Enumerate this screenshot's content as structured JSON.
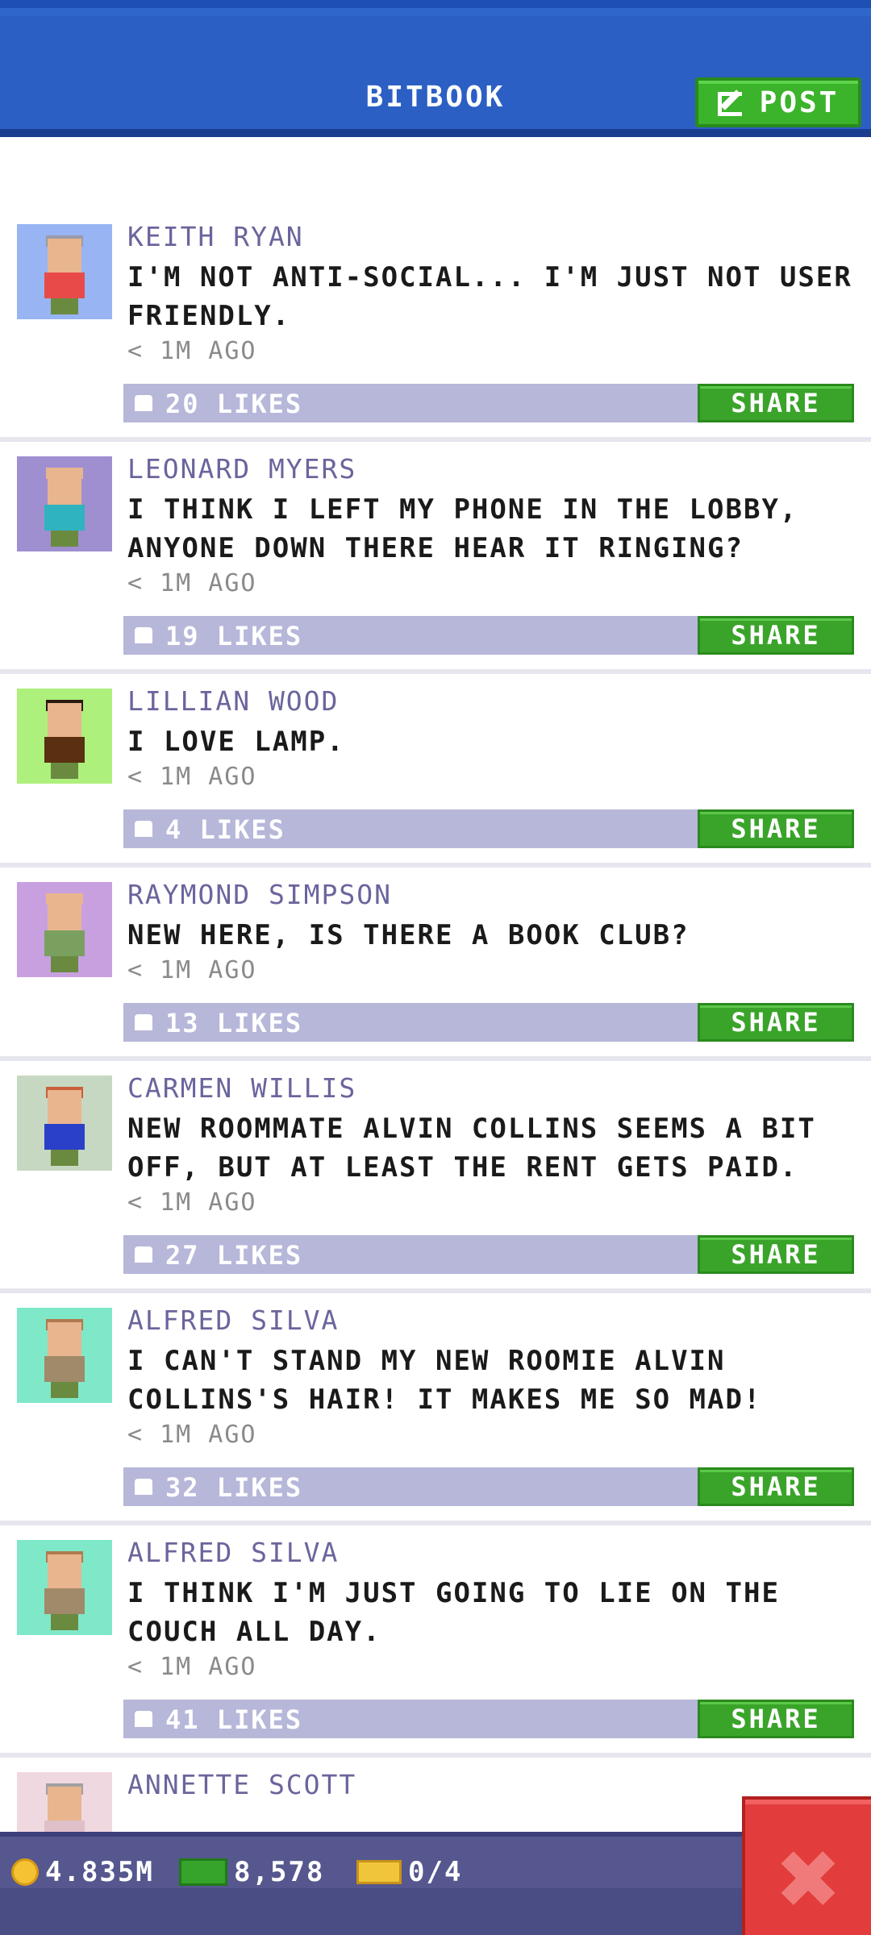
{
  "header": {
    "title": "BITBOOK",
    "post_label": "POST"
  },
  "posts": [
    {
      "name": "KEITH RYAN",
      "text": "I'M NOT ANTI-SOCIAL... I'M JUST NOT USER FRIENDLY.",
      "time": "< 1M AGO",
      "likes": "20 LIKES",
      "share": "SHARE",
      "avatar_bg": "#98b4f2",
      "shirt": "#e84a4a",
      "hair": "#9a9aa6",
      "lines": 2
    },
    {
      "name": "LEONARD MYERS",
      "text": "I THINK I LEFT MY PHONE IN THE LOBBY, ANYONE DOWN THERE HEAR IT RINGING?",
      "time": "< 1M AGO",
      "likes": "19 LIKES",
      "share": "SHARE",
      "avatar_bg": "#9f8fd0",
      "shirt": "#2fb3c0",
      "hair": "#e9b58f",
      "lines": 2
    },
    {
      "name": "LILLIAN WOOD",
      "text": "I LOVE LAMP.",
      "time": "< 1M AGO",
      "likes": "4 LIKES",
      "share": "SHARE",
      "avatar_bg": "#aef07c",
      "shirt": "#5a3010",
      "hair": "#2a1a10",
      "lines": 1
    },
    {
      "name": "RAYMOND SIMPSON",
      "text": "NEW HERE, IS THERE A BOOK CLUB?",
      "time": "< 1M AGO",
      "likes": "13 LIKES",
      "share": "SHARE",
      "avatar_bg": "#c8a0e0",
      "shirt": "#7aa060",
      "hair": "#e9b58f",
      "lines": 1
    },
    {
      "name": "CARMEN WILLIS",
      "text": "NEW ROOMMATE ALVIN COLLINS SEEMS A BIT OFF, BUT AT LEAST THE RENT GETS PAID.",
      "time": "< 1M AGO",
      "likes": "27 LIKES",
      "share": "SHARE",
      "avatar_bg": "#c6d8c2",
      "shirt": "#2a40c8",
      "hair": "#c8603a",
      "lines": 2
    },
    {
      "name": "ALFRED SILVA",
      "text": "I CAN'T STAND MY NEW ROOMIE ALVIN COLLINS'S HAIR! IT MAKES ME SO MAD!",
      "time": "< 1M AGO",
      "likes": "32 LIKES",
      "share": "SHARE",
      "avatar_bg": "#7ee8c8",
      "shirt": "#a08a6a",
      "hair": "#b07a50",
      "lines": 2
    },
    {
      "name": "ALFRED SILVA",
      "text": "I THINK I'M JUST GOING TO LIE ON THE COUCH ALL DAY.",
      "time": "< 1M AGO",
      "likes": "41 LIKES",
      "share": "SHARE",
      "avatar_bg": "#7ee8c8",
      "shirt": "#a08a6a",
      "hair": "#b07a50",
      "lines": 2
    },
    {
      "name": "ANNETTE SCOTT",
      "text": "",
      "time": "",
      "likes": "",
      "share": "",
      "avatar_bg": "#f0d8e0",
      "shirt": "#e0c0c8",
      "hair": "#a0a0a0",
      "lines": 0
    }
  ],
  "status": {
    "coins": "4.835M",
    "bux": "8,578",
    "tickets": "0/4"
  },
  "colors": {
    "header": "#2b5fc4",
    "share": "#3aa42a",
    "like_bar": "#b6b7d9",
    "close": "#e23c3c"
  }
}
